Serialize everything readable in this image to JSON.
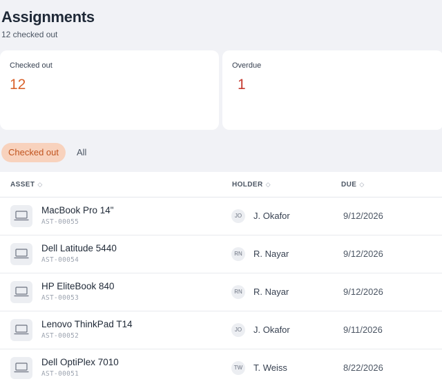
{
  "header": {
    "title": "Assignments",
    "subtitle": "12 checked out"
  },
  "cards": [
    {
      "label": "Checked out",
      "value": "12",
      "color": "#d9622b"
    },
    {
      "label": "Overdue",
      "value": "1",
      "color": "#c53a2f"
    }
  ],
  "tabs": [
    {
      "label": "Checked out",
      "active": true
    },
    {
      "label": "All",
      "active": false
    }
  ],
  "table": {
    "columns": [
      {
        "label": "ASSET",
        "sort_icon": "sort-icon"
      },
      {
        "label": "HOLDER",
        "sort_icon": "sort-icon"
      },
      {
        "label": "DUE",
        "sort_icon": "sort-icon"
      }
    ],
    "rows": [
      {
        "name": "MacBook Pro 14\"",
        "id": "AST-00055",
        "initials": "JO",
        "holder": "J. Okafor",
        "due": "9/12/2026",
        "icon": "laptop-icon"
      },
      {
        "name": "Dell Latitude 5440",
        "id": "AST-00054",
        "initials": "RN",
        "holder": "R. Nayar",
        "due": "9/12/2026",
        "icon": "laptop-icon"
      },
      {
        "name": "HP EliteBook 840",
        "id": "AST-00053",
        "initials": "RN",
        "holder": "R. Nayar",
        "due": "9/12/2026",
        "icon": "laptop-icon"
      },
      {
        "name": "Lenovo ThinkPad T14",
        "id": "AST-00052",
        "initials": "JO",
        "holder": "J. Okafor",
        "due": "9/11/2026",
        "icon": "laptop-icon"
      },
      {
        "name": "Dell OptiPlex 7010",
        "id": "AST-00051",
        "initials": "TW",
        "holder": "T. Weiss",
        "due": "8/22/2026",
        "icon": "laptop-icon"
      }
    ]
  },
  "colors": {
    "accent": "#d9622b",
    "overdue": "#c53a2f",
    "tab_active_bg": "#f8d2bd"
  }
}
